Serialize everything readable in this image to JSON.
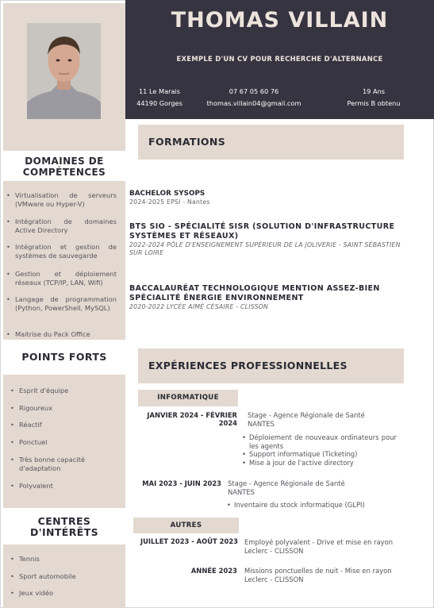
{
  "header": {
    "name": "THOMAS VILLAIN",
    "subtitle": "EXEMPLE D'UN CV POUR RECHERCHE D'ALTERNANCE",
    "address_line1": "11 Le Marais",
    "address_line2": "44190 Gorges",
    "phone": "07 67 05 60 76",
    "email": "thomas.villain04@gmail.com",
    "age": "19 Ans",
    "license": "Permis B obtenu"
  },
  "sidebar": {
    "skills_title": "DOMAINES DE COMPÉTENCES",
    "skills": [
      "Virtualisation de serveurs (VMware ou Hyper-V)",
      "Intégration de domaines Active Directory",
      "Intégration et gestion de systèmes de sauvegarde",
      "Gestion et déploiement réseaux (TCP/IP, LAN, Wifi)",
      "Langage de programmation (Python, PowerShell, MySQL)",
      "Maitrise du Pack Office"
    ],
    "strengths_title": "POINTS FORTS",
    "strengths": [
      "Esprit d'équipe",
      "Rigoureux",
      "Réactif",
      "Ponctuel",
      "Très bonne capacité d'adaptation",
      "Polyvalent"
    ],
    "interests_title": "CENTRES D'INTÉRÊTS",
    "interests": [
      "Tennis",
      "Sport automobile",
      "Jeux vidéo"
    ]
  },
  "formations": {
    "title": "FORMATIONS",
    "items": [
      {
        "title": "BACHELOR SYSOPS",
        "sub": "2024-2025 EPSI - Nantes"
      },
      {
        "title": "BTS SIO - SPÉCIALITÉ SISR (SOLUTION D'INFRASTRUCTURE SYSTÈMES ET RÉSEAUX)",
        "sub": "2022-2024  PÔLE D'ENSEIGNEMENT SUPÉRIEUR DE LA JOLIVERIE - SAINT SÉBASTIEN SUR LOIRE"
      },
      {
        "title": "BACCALAURÉAT TECHNOLOGIQUE MENTION ASSEZ-BIEN SPÉCIALITÉ ÉNERGIE ENVIRONNEMENT",
        "sub": "2020-2022  LYCÉE AIMÉ CÉSAIRE - CLISSON"
      }
    ]
  },
  "experiences": {
    "title": "EXPÉRIENCES PROFESSIONNELLES",
    "tag_info": "INFORMATIQUE",
    "tag_other": "AUTRES",
    "jobs": [
      {
        "date": "JANVIER 2024 - FÉVRIER 2024",
        "desc": "Stage - Agence Régionale de Santé NANTES",
        "bullets": [
          "Déploiement de nouveaux ordinateurs pour les agents",
          "Support informatique (Ticketing)",
          "Mise à jour de l'active directory"
        ]
      },
      {
        "date": "MAI 2023 - JUIN 2023",
        "desc": "Stage - Agence Régionale de Santé NANTES",
        "bullets": [
          "Inventaire du stock informatique (GLPI)"
        ]
      },
      {
        "date": "JUILLET 2023 - AOÛT 2023",
        "desc": "Employé polyvalent - Drive et mise en rayon Leclerc - CLISSON"
      },
      {
        "date": "ANNÉE 2023",
        "desc": "Missions ponctuelles de nuit - Mise en rayon Leclerc - CLISSON"
      }
    ]
  },
  "colors": {
    "header_bg": "#353440",
    "accent_beige": "#e3d9d0",
    "text": "#2a2a33"
  },
  "icons": {
    "photo": "profile-photo"
  }
}
